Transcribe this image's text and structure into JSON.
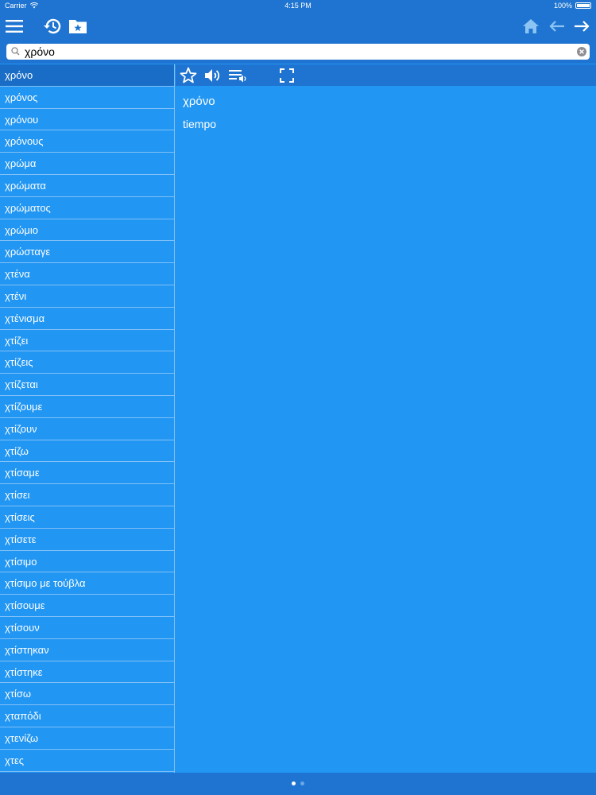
{
  "status_bar": {
    "carrier": "Carrier",
    "time": "4:15 PM",
    "battery": "100%"
  },
  "navbar": {
    "icons": [
      "menu-icon",
      "history-icon",
      "favorites-folder-icon",
      "home-icon",
      "back-arrow-icon",
      "forward-arrow-icon"
    ]
  },
  "search": {
    "value": "χρόνο",
    "placeholder": ""
  },
  "word_list": {
    "selected_index": 0,
    "items": [
      "χρόνο",
      "χρόνος",
      "χρόνου",
      "χρόνους",
      "χρώμα",
      "χρώματα",
      "χρώματος",
      "χρώμιο",
      "χρώσταγε",
      "χτένα",
      "χτένι",
      "χτένισμα",
      "χτίζει",
      "χτίζεις",
      "χτίζεται",
      "χτίζουμε",
      "χτίζουν",
      "χτίζω",
      "χτίσαμε",
      "χτίσει",
      "χτίσεις",
      "χτίσετε",
      "χτίσιμο",
      "χτίσιμο με τούβλα",
      "χτίσουμε",
      "χτίσουν",
      "χτίστηκαν",
      "χτίστηκε",
      "χτίσω",
      "χταπόδι",
      "χτενίζω",
      "χτες"
    ]
  },
  "detail_toolbar": {
    "icons": [
      "favorite-star-icon",
      "speaker-icon",
      "playlist-audio-icon",
      "fullscreen-icon"
    ]
  },
  "detail": {
    "word": "χρόνο",
    "translation": "tiempo"
  },
  "page_indicator": {
    "total": 2,
    "current": 1
  },
  "colors": {
    "bar": "#1e74d0",
    "content": "#2196f3",
    "selected": "#1a6dc6",
    "divider": "#82c0f5"
  }
}
